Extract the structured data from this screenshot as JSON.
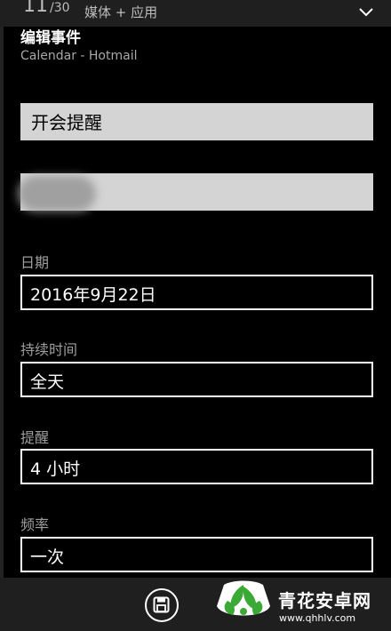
{
  "status_bar": {
    "date_day": "11",
    "date_rest": "/30",
    "category": "媒体 + 应用",
    "expand_icon": "chevron-down-icon"
  },
  "header": {
    "title": "编辑事件",
    "subtitle": "Calendar - Hotmail"
  },
  "fields": {
    "subject_value": "开会提醒",
    "location_value": "",
    "date_label": "日期",
    "date_value": "2016年9月22日",
    "duration_label": "持续时间",
    "duration_value": "全天",
    "reminder_label": "提醒",
    "reminder_value": "4 小时",
    "frequency_label": "频率",
    "frequency_value": "一次"
  },
  "app_bar": {
    "save_icon": "save-icon"
  },
  "watermark": {
    "name": "青花安卓网",
    "url": "www.qhhlv.com",
    "logo_color": "#3aa935"
  }
}
